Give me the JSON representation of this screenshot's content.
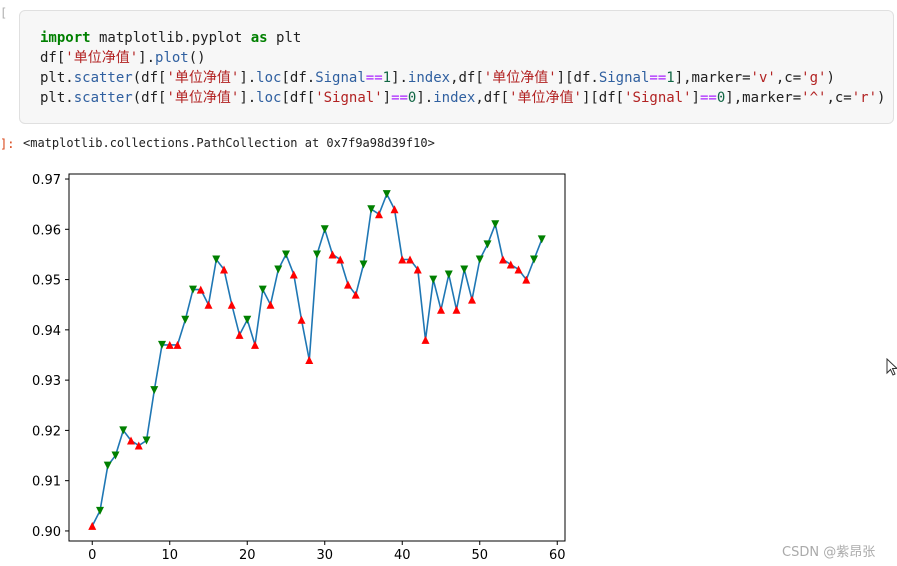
{
  "cell": {
    "input_prompt_mark": "[",
    "code_tokens": [
      [
        {
          "t": "import",
          "c": "kw"
        },
        {
          "t": " matplotlib.pyplot ",
          "c": ""
        },
        {
          "t": "as",
          "c": "kw"
        },
        {
          "t": " plt",
          "c": ""
        }
      ],
      [
        {
          "t": "df[",
          "c": ""
        },
        {
          "t": "'单位净值'",
          "c": "str"
        },
        {
          "t": "].",
          "c": ""
        },
        {
          "t": "plot",
          "c": "attr"
        },
        {
          "t": "()",
          "c": ""
        }
      ],
      [
        {
          "t": "plt.",
          "c": ""
        },
        {
          "t": "scatter",
          "c": "attr"
        },
        {
          "t": "(df[",
          "c": ""
        },
        {
          "t": "'单位净值'",
          "c": "str"
        },
        {
          "t": "].",
          "c": ""
        },
        {
          "t": "loc",
          "c": "attr"
        },
        {
          "t": "[df.",
          "c": ""
        },
        {
          "t": "Signal",
          "c": "attr"
        },
        {
          "t": "==",
          "c": "op"
        },
        {
          "t": "1",
          "c": "num"
        },
        {
          "t": "].",
          "c": ""
        },
        {
          "t": "index",
          "c": "attr"
        },
        {
          "t": ",df[",
          "c": ""
        },
        {
          "t": "'单位净值'",
          "c": "str"
        },
        {
          "t": "][df.",
          "c": ""
        },
        {
          "t": "Signal",
          "c": "attr"
        },
        {
          "t": "==",
          "c": "op"
        },
        {
          "t": "1",
          "c": "num"
        },
        {
          "t": "],marker=",
          "c": ""
        },
        {
          "t": "'v'",
          "c": "str"
        },
        {
          "t": ",c=",
          "c": ""
        },
        {
          "t": "'g'",
          "c": "str"
        },
        {
          "t": ")",
          "c": ""
        }
      ],
      [
        {
          "t": "plt.",
          "c": ""
        },
        {
          "t": "scatter",
          "c": "attr"
        },
        {
          "t": "(df[",
          "c": ""
        },
        {
          "t": "'单位净值'",
          "c": "str"
        },
        {
          "t": "].",
          "c": ""
        },
        {
          "t": "loc",
          "c": "attr"
        },
        {
          "t": "[df[",
          "c": ""
        },
        {
          "t": "'Signal'",
          "c": "str"
        },
        {
          "t": "]",
          "c": ""
        },
        {
          "t": "==",
          "c": "op"
        },
        {
          "t": "0",
          "c": "num"
        },
        {
          "t": "].",
          "c": ""
        },
        {
          "t": "index",
          "c": "attr"
        },
        {
          "t": ",df[",
          "c": ""
        },
        {
          "t": "'单位净值'",
          "c": "str"
        },
        {
          "t": "][df[",
          "c": ""
        },
        {
          "t": "'Signal'",
          "c": "str"
        },
        {
          "t": "]",
          "c": ""
        },
        {
          "t": "==",
          "c": "op"
        },
        {
          "t": "0",
          "c": "num"
        },
        {
          "t": "],marker=",
          "c": ""
        },
        {
          "t": "'^'",
          "c": "str"
        },
        {
          "t": ",c=",
          "c": ""
        },
        {
          "t": "'r'",
          "c": "str"
        },
        {
          "t": ")",
          "c": ""
        }
      ]
    ],
    "output_prompt_mark": "]:",
    "output_text": "<matplotlib.collections.PathCollection at 0x7f9a98d39f10>"
  },
  "watermark": "CSDN @紫昂张",
  "chart_data": {
    "type": "line",
    "xlim": [
      -3,
      61
    ],
    "ylim": [
      0.898,
      0.971
    ],
    "x_ticks": [
      0,
      10,
      20,
      30,
      40,
      50,
      60
    ],
    "y_ticks": [
      0.9,
      0.91,
      0.92,
      0.93,
      0.94,
      0.95,
      0.96,
      0.97
    ],
    "x_tick_labels": [
      "0",
      "10",
      "20",
      "30",
      "40",
      "50",
      "60"
    ],
    "y_tick_labels": [
      "0.90",
      "0.91",
      "0.92",
      "0.93",
      "0.94",
      "0.95",
      "0.96",
      "0.97"
    ],
    "line_color": "#1f77b4",
    "buy_color": "#008000",
    "sell_color": "#ff0000",
    "series": [
      {
        "name": "单位净值",
        "values": [
          0.901,
          0.904,
          0.913,
          0.915,
          0.92,
          0.918,
          0.917,
          0.918,
          0.928,
          0.937,
          0.937,
          0.937,
          0.942,
          0.948,
          0.948,
          0.945,
          0.954,
          0.952,
          0.945,
          0.939,
          0.942,
          0.937,
          0.948,
          0.945,
          0.952,
          0.955,
          0.951,
          0.942,
          0.934,
          0.955,
          0.96,
          0.955,
          0.954,
          0.949,
          0.947,
          0.953,
          0.964,
          0.963,
          0.967,
          0.964,
          0.954,
          0.954,
          0.952,
          0.938,
          0.95,
          0.944,
          0.951,
          0.944,
          0.952,
          0.946,
          0.954,
          0.957,
          0.961,
          0.954,
          0.953,
          0.952,
          0.95,
          0.954,
          0.958
        ]
      }
    ],
    "signal": [
      0,
      1,
      1,
      1,
      1,
      0,
      0,
      1,
      1,
      1,
      0,
      0,
      1,
      1,
      0,
      0,
      1,
      0,
      0,
      0,
      1,
      0,
      1,
      0,
      1,
      1,
      0,
      0,
      0,
      1,
      1,
      0,
      0,
      0,
      0,
      1,
      1,
      0,
      1,
      0,
      0,
      0,
      0,
      0,
      1,
      0,
      1,
      0,
      1,
      0,
      1,
      1,
      1,
      0,
      0,
      0,
      0,
      1,
      1
    ]
  }
}
